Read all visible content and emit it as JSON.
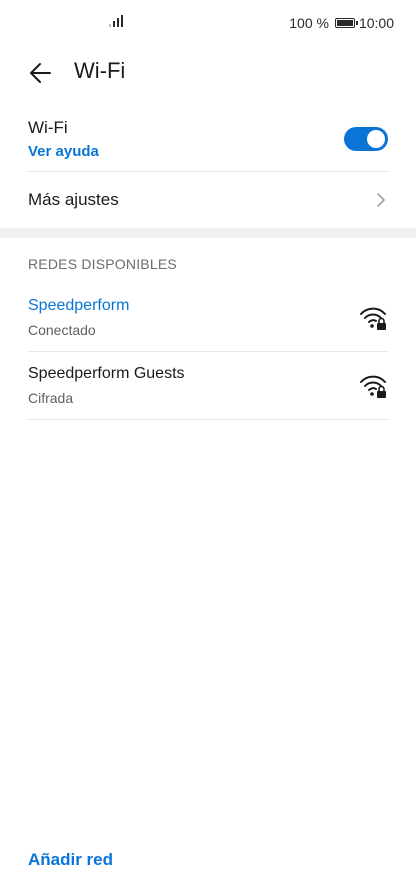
{
  "status_bar": {
    "battery_percent": "100 %",
    "time": "10:00",
    "battery_level": 1.0
  },
  "header": {
    "title": "Wi-Fi"
  },
  "wifi": {
    "label": "Wi-Fi",
    "help_link": "Ver ayuda",
    "toggle_on": true
  },
  "more_settings": {
    "label": "Más ajustes"
  },
  "networks": {
    "section_title": "REDES DISPONIBLES",
    "items": [
      {
        "name": "Speedperform",
        "status": "Conectado",
        "connected": true
      },
      {
        "name": "Speedperform Guests",
        "status": "Cifrada",
        "connected": false
      }
    ]
  },
  "footer": {
    "add_network": "Añadir red"
  },
  "colors": {
    "accent": "#0a75d6",
    "text_primary": "#1a1a1a",
    "text_secondary": "#606060",
    "divider": "#e6e6e6"
  }
}
